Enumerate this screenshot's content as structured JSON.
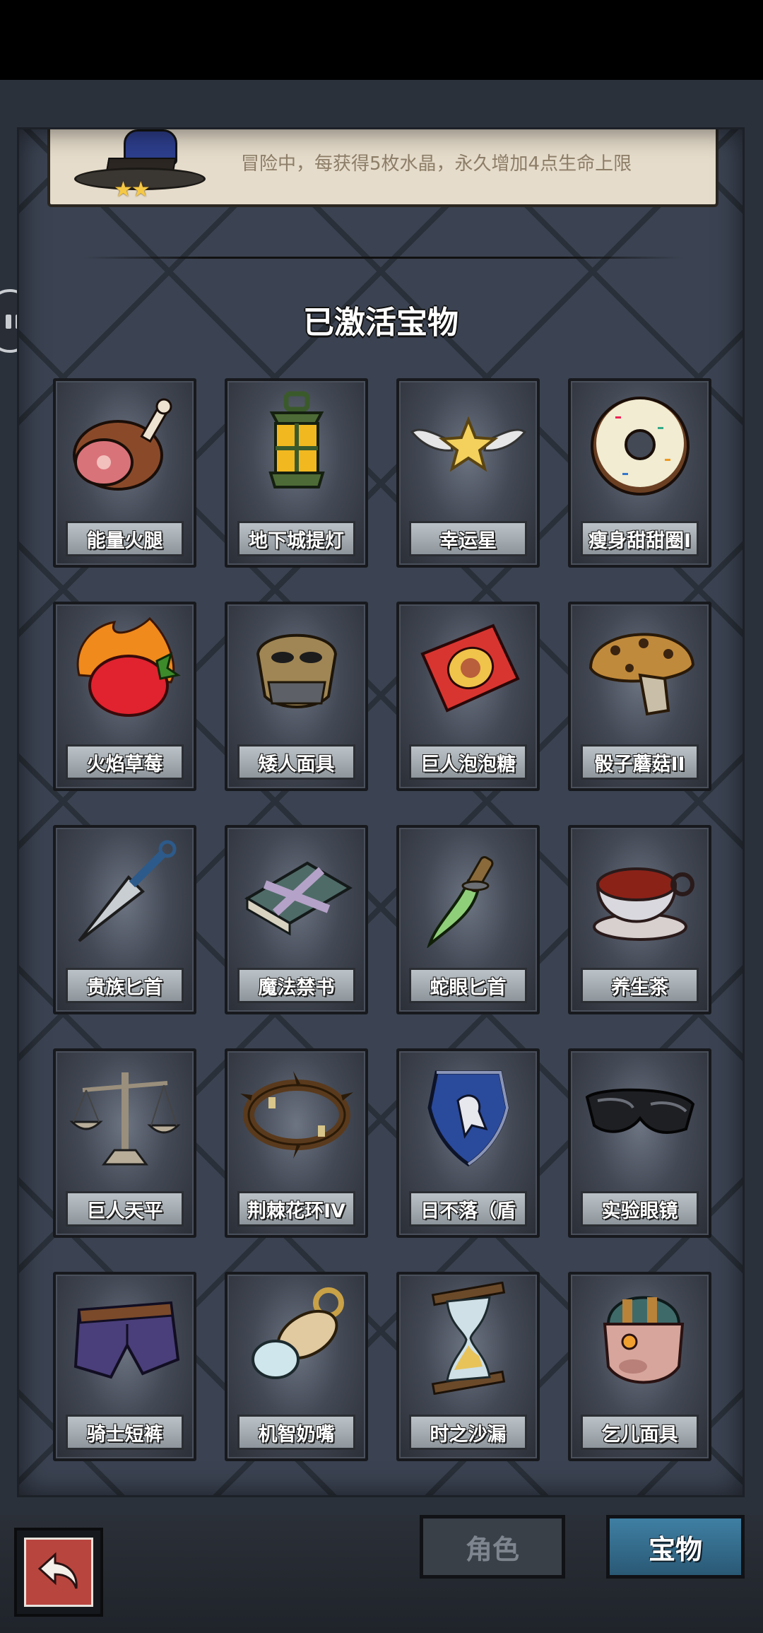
{
  "info_card": {
    "text": "冒险中，每获得5枚水晶，永久增加4点生命上限",
    "stars": "★★"
  },
  "section_title": "已激活宝物",
  "items": [
    {
      "label": "能量火腿",
      "icon": "ham-icon"
    },
    {
      "label": "地下城提灯",
      "icon": "lantern-icon"
    },
    {
      "label": "幸运星",
      "icon": "winged-star-icon"
    },
    {
      "label": "瘦身甜甜圈I",
      "icon": "donut-icon"
    },
    {
      "label": "火焰草莓",
      "icon": "flaming-strawberry-icon"
    },
    {
      "label": "矮人面具",
      "icon": "dwarf-mask-icon"
    },
    {
      "label": "巨人泡泡糖",
      "icon": "bubblegum-box-icon"
    },
    {
      "label": "骰子蘑菇II",
      "icon": "dice-mushroom-icon"
    },
    {
      "label": "贵族匕首",
      "icon": "kunai-icon"
    },
    {
      "label": "魔法禁书",
      "icon": "forbidden-book-icon"
    },
    {
      "label": "蛇眼匕首",
      "icon": "curved-dagger-icon"
    },
    {
      "label": "养生茶",
      "icon": "teacup-icon"
    },
    {
      "label": "巨人天平",
      "icon": "scales-icon"
    },
    {
      "label": "荆棘花环IV",
      "icon": "thorn-wreath-icon"
    },
    {
      "label": "日不落（盾",
      "icon": "shield-icon"
    },
    {
      "label": "实验眼镜",
      "icon": "goggles-icon"
    },
    {
      "label": "骑士短裤",
      "icon": "shorts-icon"
    },
    {
      "label": "机智奶嘴",
      "icon": "pacifier-icon"
    },
    {
      "label": "时之沙漏",
      "icon": "hourglass-icon"
    },
    {
      "label": "乞儿面具",
      "icon": "beggar-mask-icon"
    }
  ],
  "tabs": {
    "role": "角色",
    "treasure": "宝物"
  }
}
